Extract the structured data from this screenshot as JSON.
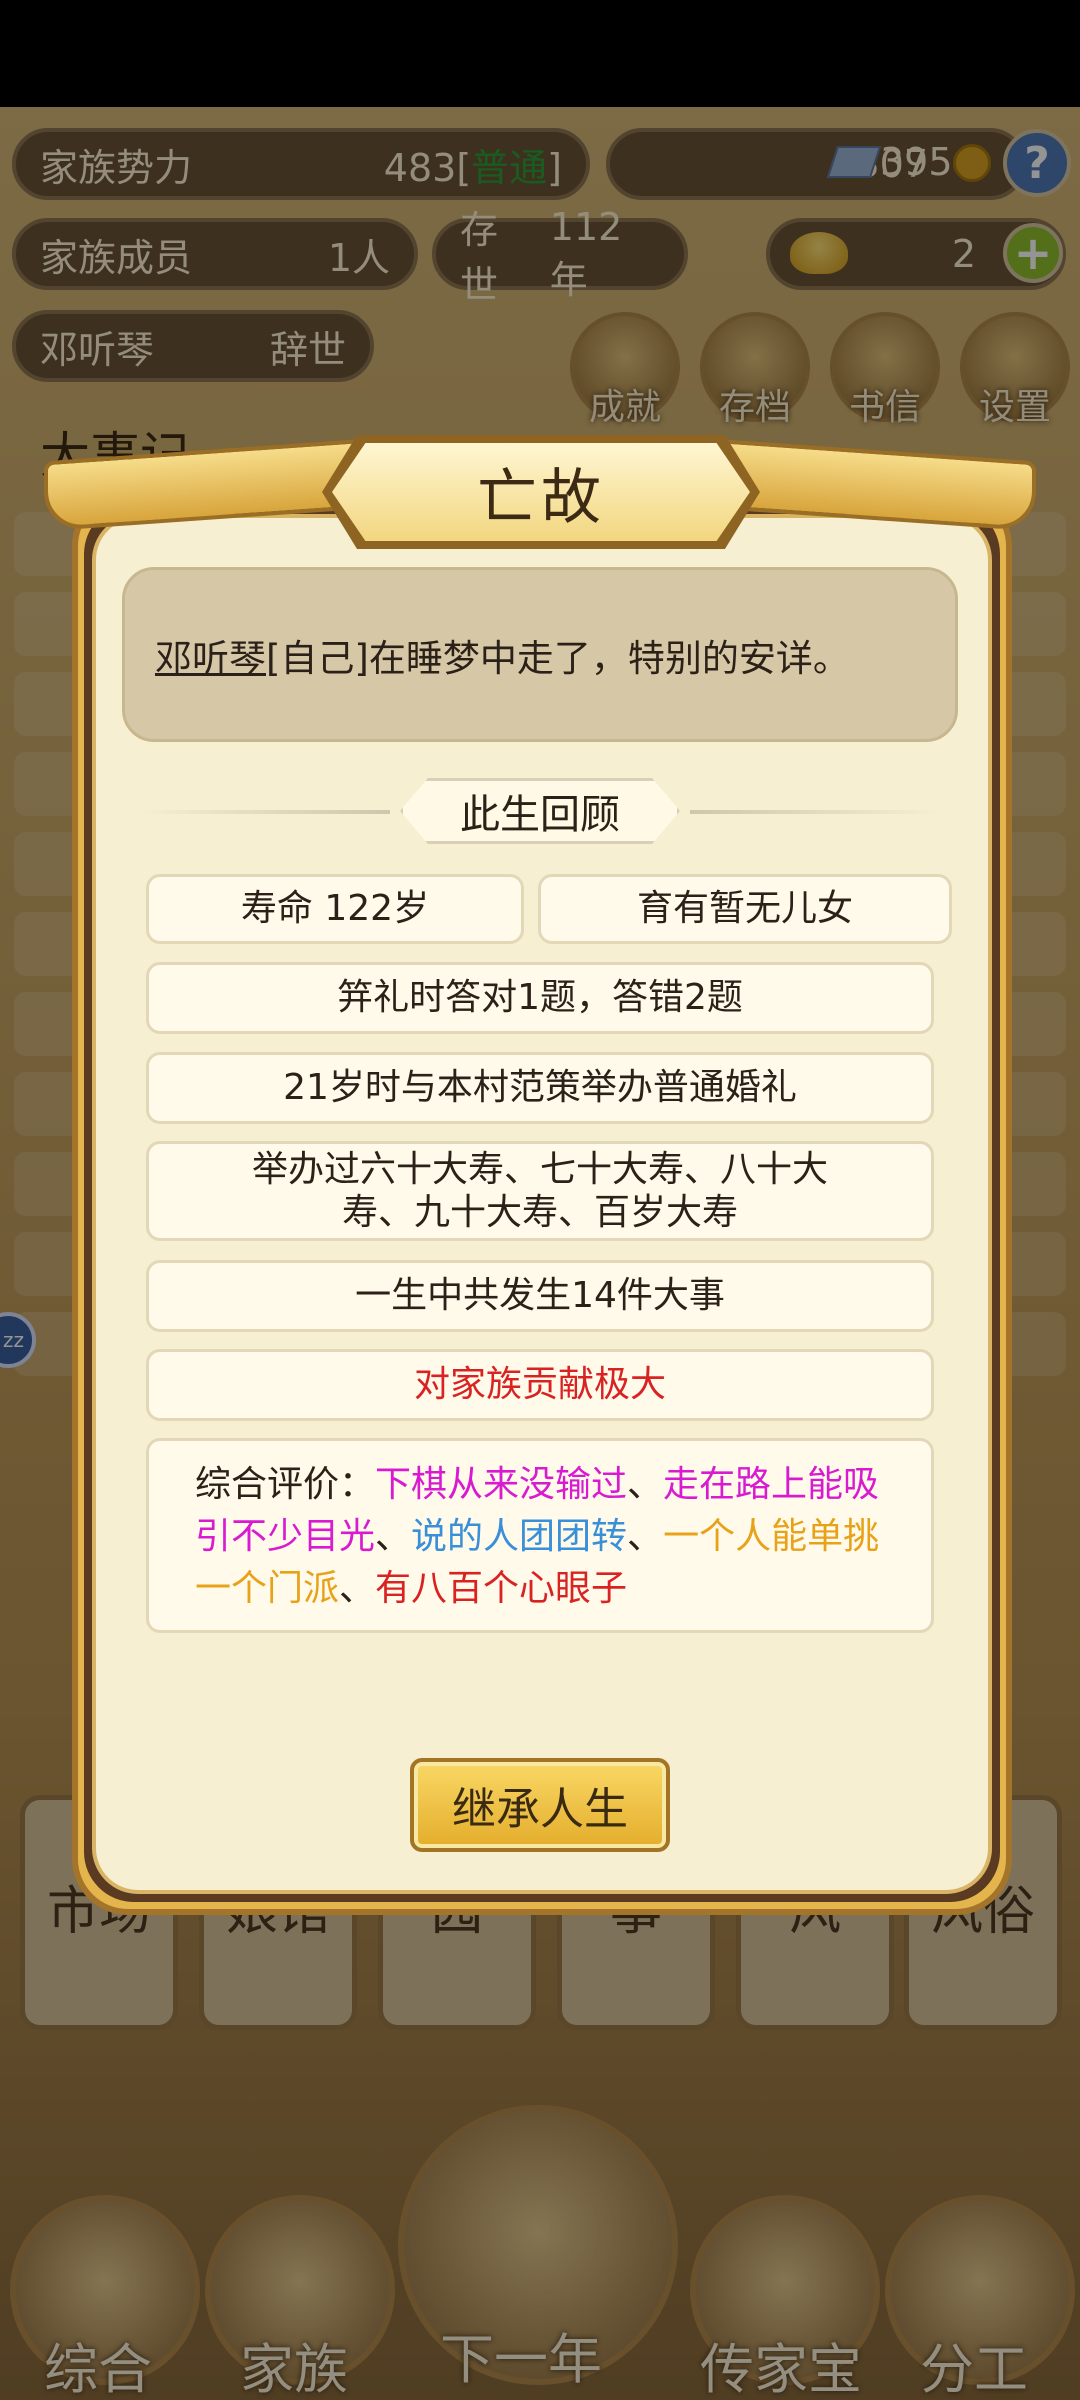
{
  "header": {
    "family_power_label": "家族势力",
    "family_power_value": "483",
    "family_power_bracket_open": "[",
    "family_power_level": "普通",
    "family_power_bracket_close": "]",
    "silver_value": "307",
    "coin_value": "395",
    "members_label": "家族成员",
    "members_value": "1人",
    "existence_label": "存世",
    "existence_value": "112年",
    "ingot_value": "2",
    "person_name": "邓听琴",
    "person_status": "辞世"
  },
  "top_icons": [
    "成就",
    "存档",
    "书信",
    "设置"
  ],
  "background_section_title": "大事记",
  "dialog": {
    "title": "亡故",
    "message_name": "邓听琴",
    "message_rest": "[自己]在睡梦中走了，特别的安详。",
    "review_title": "此生回顾",
    "lifespan": "寿命 122岁",
    "children": "育有暂无儿女",
    "ceremony": "笄礼时答对1题，答错2题",
    "marriage": "21岁时与本村范策举办普通婚礼",
    "birthdays": "举办过六十大寿、七十大寿、八十大寿、九十大寿、百岁大寿",
    "events": "一生中共发生14件大事",
    "contribution": "对家族贡献极大",
    "evaluation_label": "综合评价：",
    "evaluation_items": [
      {
        "text": "下棋从来没输过",
        "color": "#d81bd1"
      },
      {
        "text": "走在路上能吸引不少目光",
        "color": "#d81bd1"
      },
      {
        "text": "说的人团团转",
        "color": "#3a8fd9"
      },
      {
        "text": "一个人能单挑一个门派",
        "color": "#e8a21a"
      },
      {
        "text": "有八百个心眼子",
        "color": "#d92323"
      }
    ],
    "separator": "、",
    "inherit_button": "继承人生"
  },
  "bottom_tabs": [
    "市场",
    "娘馆",
    "园",
    "事",
    "风",
    "风俗"
  ],
  "bottom_nav": [
    "综合",
    "家族",
    "下一年",
    "传家宝",
    "分工"
  ],
  "colors": {
    "dialog_bg": "#f7efd1",
    "dialog_frame": "#e4b54d",
    "button": "#f0c443",
    "contribution_red": "#d92323"
  }
}
